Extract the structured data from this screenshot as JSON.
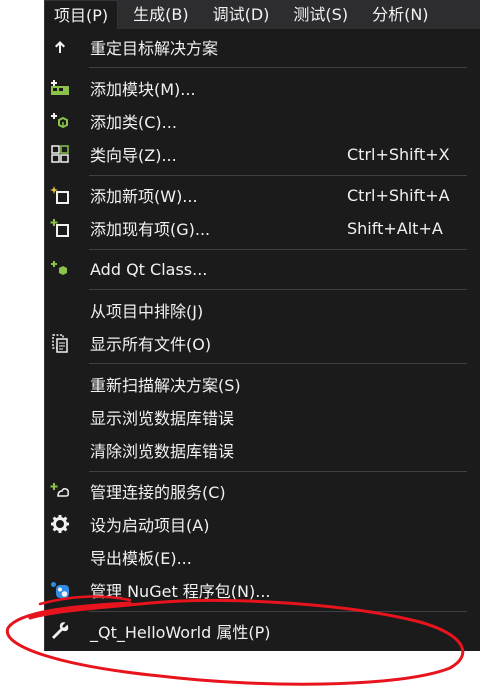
{
  "menubar": {
    "items": [
      {
        "label": "项目(P)",
        "active": true
      },
      {
        "label": "生成(B)"
      },
      {
        "label": "调试(D)"
      },
      {
        "label": "测试(S)"
      },
      {
        "label": "分析(N)"
      }
    ]
  },
  "menu": {
    "items": [
      {
        "label": "重定目标解决方案",
        "icon": "arrow-up-icon"
      },
      {
        "label": "添加模块(M)...",
        "icon": "add-module-icon"
      },
      {
        "label": "添加类(C)...",
        "icon": "add-class-icon"
      },
      {
        "label": "类向导(Z)...",
        "shortcut": "Ctrl+Shift+X",
        "icon": "class-wizard-icon"
      },
      {
        "label": "添加新项(W)...",
        "shortcut": "Ctrl+Shift+A",
        "icon": "add-new-item-icon"
      },
      {
        "label": "添加现有项(G)...",
        "shortcut": "Shift+Alt+A",
        "icon": "add-existing-item-icon"
      },
      {
        "label": "Add Qt Class...",
        "icon": "add-qt-class-icon"
      },
      {
        "label": "从项目中排除(J)"
      },
      {
        "label": "显示所有文件(O)",
        "icon": "show-all-files-icon"
      },
      {
        "label": "重新扫描解决方案(S)"
      },
      {
        "label": "显示浏览数据库错误"
      },
      {
        "label": "清除浏览数据库错误"
      },
      {
        "label": "管理连接的服务(C)",
        "icon": "connected-services-icon"
      },
      {
        "label": "设为启动项目(A)",
        "icon": "gear-icon"
      },
      {
        "label": "导出模板(E)..."
      },
      {
        "label": "管理 NuGet 程序包(N)...",
        "icon": "nuget-icon"
      },
      {
        "label": "_Qt_HelloWorld 属性(P)",
        "icon": "wrench-icon"
      }
    ]
  },
  "colors": {
    "menu_bg": "#1b1b1c",
    "menubar_bg": "#2d2d30",
    "text": "#f1f1f1",
    "separator": "#3f3f46",
    "icon_green": "#8ac24a",
    "icon_blue": "#2f8de4",
    "annotation_red": "#e8141d"
  }
}
